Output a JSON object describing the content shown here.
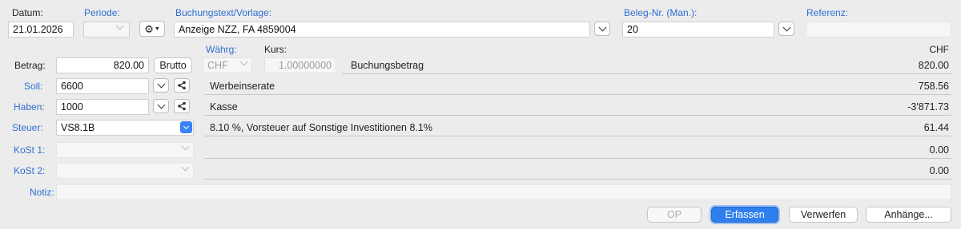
{
  "header": {
    "datum_label": "Datum:",
    "datum_value": "21.01.2026",
    "periode_label": "Periode:",
    "buchungstext_label": "Buchungstext/Vorlage:",
    "buchungstext_value": "Anzeige NZZ, FA 4859004",
    "beleg_label": "Beleg-Nr. (Man.):",
    "beleg_value": "20",
    "referenz_label": "Referenz:",
    "referenz_value": ""
  },
  "currency": {
    "waehrg_label": "Währg:",
    "waehrg_value": "CHF",
    "kurs_label": "Kurs:",
    "kurs_value": "1.00000000",
    "chf_header": "CHF"
  },
  "left": {
    "betrag_label": "Betrag:",
    "betrag_value": "820.00",
    "brutto_label": "Brutto",
    "soll_label": "Soll:",
    "soll_value": "6600",
    "haben_label": "Haben:",
    "haben_value": "1000",
    "steuer_label": "Steuer:",
    "steuer_value": "VS8.1B",
    "kost1_label": "KoSt 1:",
    "kost2_label": "KoSt 2:",
    "notiz_label": "Notiz:",
    "notiz_value": ""
  },
  "rows": [
    {
      "text": "Buchungsbetrag",
      "value": "820.00"
    },
    {
      "text": "Werbeinserate",
      "value": "758.56"
    },
    {
      "text": "Kasse",
      "value": "-3'871.73"
    },
    {
      "text": "8.10 %, Vorsteuer auf Sonstige Investitionen 8.1%",
      "value": "61.44"
    },
    {
      "text": "",
      "value": "0.00"
    },
    {
      "text": "",
      "value": "0.00"
    }
  ],
  "buttons": {
    "op": "OP",
    "erfassen": "Erfassen",
    "verwerfen": "Verwerfen",
    "anhaenge": "Anhänge..."
  },
  "icons": {
    "gear": "gear-icon",
    "share": "share-icon",
    "chevron": "chevron-down-icon"
  },
  "colors": {
    "accent": "#2f80ed",
    "label_blue": "#2f6fd0",
    "background": "#ececec"
  }
}
